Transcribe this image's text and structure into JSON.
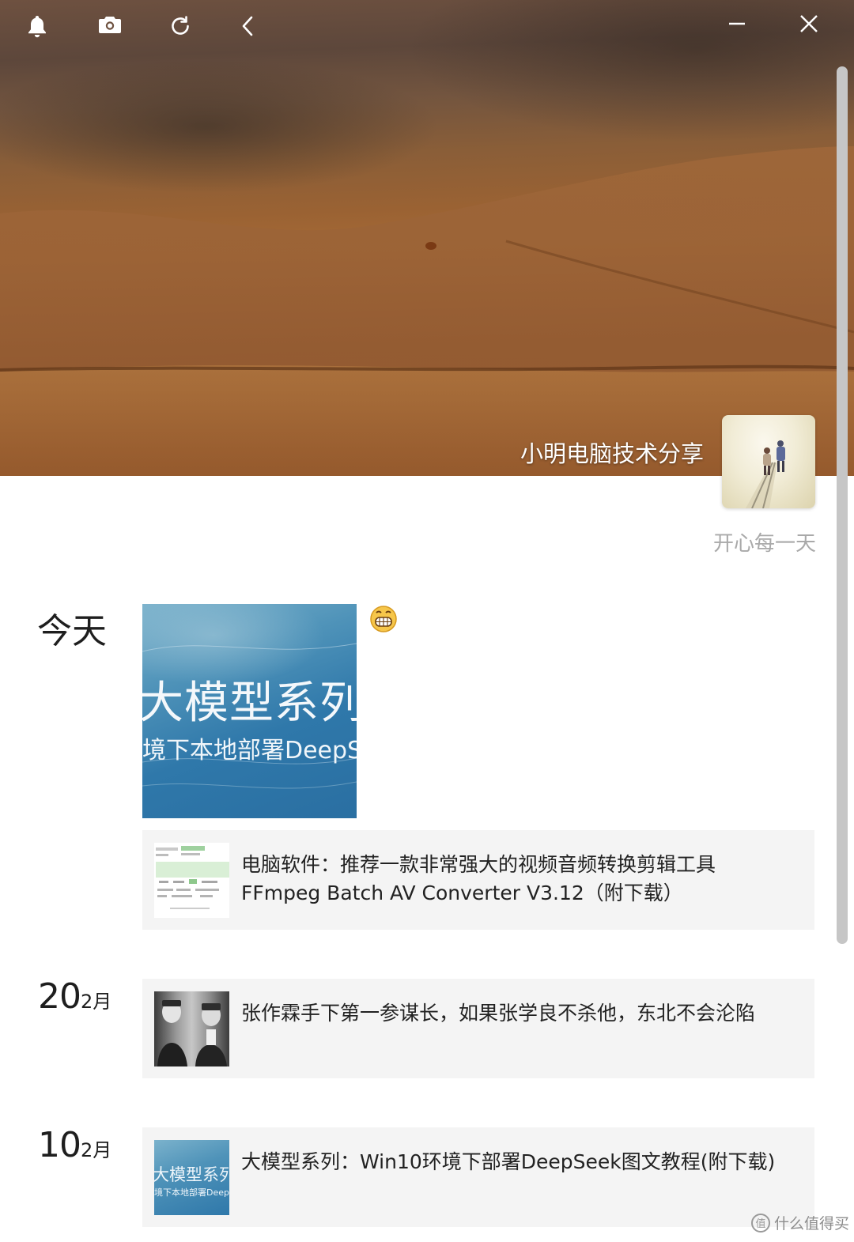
{
  "toolbar": {
    "icons": [
      "bell-icon",
      "camera-icon",
      "refresh-icon",
      "back-icon",
      "minimize-icon",
      "close-icon"
    ]
  },
  "profile": {
    "name": "小明电脑技术分享",
    "signature": "开心每一天"
  },
  "timeline": [
    {
      "date_label": "今天",
      "image_post": {
        "title": "大模型系列",
        "subtitle": "境下本地部署DeepS"
      },
      "emoji": "grinning-face-icon",
      "article": {
        "title": "电脑软件：推荐一款非常强大的视频音频转换剪辑工具FFmpeg Batch AV Converter V3.12（附下载）"
      }
    },
    {
      "date_day": "20",
      "date_month": "2月",
      "article": {
        "title": "张作霖手下第一参谋长，如果张学良不杀他，东北不会沦陷"
      }
    },
    {
      "date_day": "10",
      "date_month": "2月",
      "article": {
        "title": "大模型系列：Win10环境下部署DeepSeek图文教程(附下载)",
        "thumb_title": "大模型系列",
        "thumb_subtitle": "境下本地部署DeepS"
      }
    }
  ],
  "watermark": {
    "logo": "值",
    "text": "什么值得买"
  },
  "colors": {
    "card_bg": "#f4f4f4",
    "date_text": "#1e1e1e",
    "signature_text": "#a9a9a9",
    "scrollbar": "#c6c6c6"
  }
}
